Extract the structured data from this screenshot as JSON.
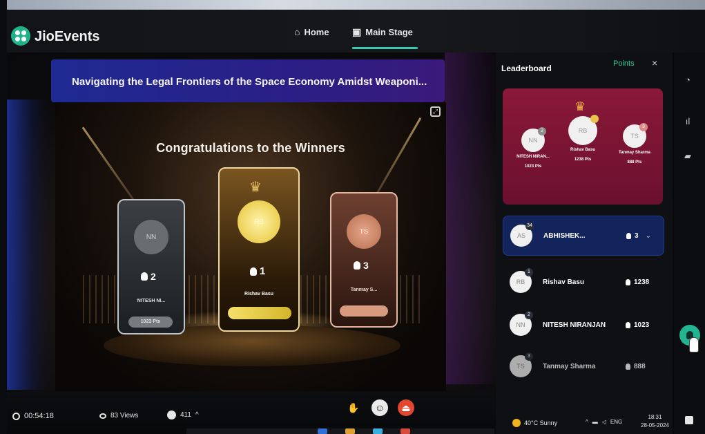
{
  "app": {
    "brand": "JioEvents",
    "nav": {
      "home_label": "Home",
      "stage_label": "Main Stage"
    }
  },
  "session": {
    "title": "Navigating the Legal Frontiers of the Space Economy Amidst Weaponi..."
  },
  "stage": {
    "heading": "Congratulations to the Winners",
    "winners": [
      {
        "initials": "NN",
        "rank": "2",
        "name": "NITESH NI...",
        "points": "1023 Pts"
      },
      {
        "initials": "RB",
        "rank": "1",
        "name": "Rishav Basu",
        "points": ""
      },
      {
        "initials": "TS",
        "rank": "3",
        "name": "Tanmay S...",
        "points": ""
      }
    ]
  },
  "leaderboard": {
    "title": "Leaderboard",
    "tab": "Points",
    "close": "×",
    "podium": [
      {
        "initials": "NN",
        "badge": "2",
        "name": "NITESH NIRAN...",
        "points": "1023 Pts"
      },
      {
        "initials": "RB",
        "badge": "",
        "name": "Rishav Basu",
        "points": "1238 Pts"
      },
      {
        "initials": "TS",
        "badge": "3",
        "name": "Tanmay Sharma",
        "points": "888 Pts"
      }
    ],
    "rows": [
      {
        "initials": "AS",
        "rank": "34",
        "name": "ABHISHEK...",
        "value": "3"
      },
      {
        "initials": "RB",
        "rank": "1",
        "name": "Rishav Basu",
        "value": "1238"
      },
      {
        "initials": "NN",
        "rank": "2",
        "name": "NITESH NIRANJAN",
        "value": "1023"
      },
      {
        "initials": "TS",
        "rank": "3",
        "name": "Tanmay Sharma",
        "value": "888"
      }
    ]
  },
  "controls": {
    "timer": "00:54:18",
    "views": "83 Views",
    "online": "411"
  },
  "system": {
    "weather": "40°C  Sunny",
    "lang": "ENG",
    "time": "18:31",
    "date": "28-05-2024"
  },
  "colors": {
    "accent": "#38c9b0",
    "session_bar": "#1f2a92",
    "leaderboard_podium": "#8a1838",
    "my_row": "#13245c",
    "leave_button": "#e2462f"
  }
}
